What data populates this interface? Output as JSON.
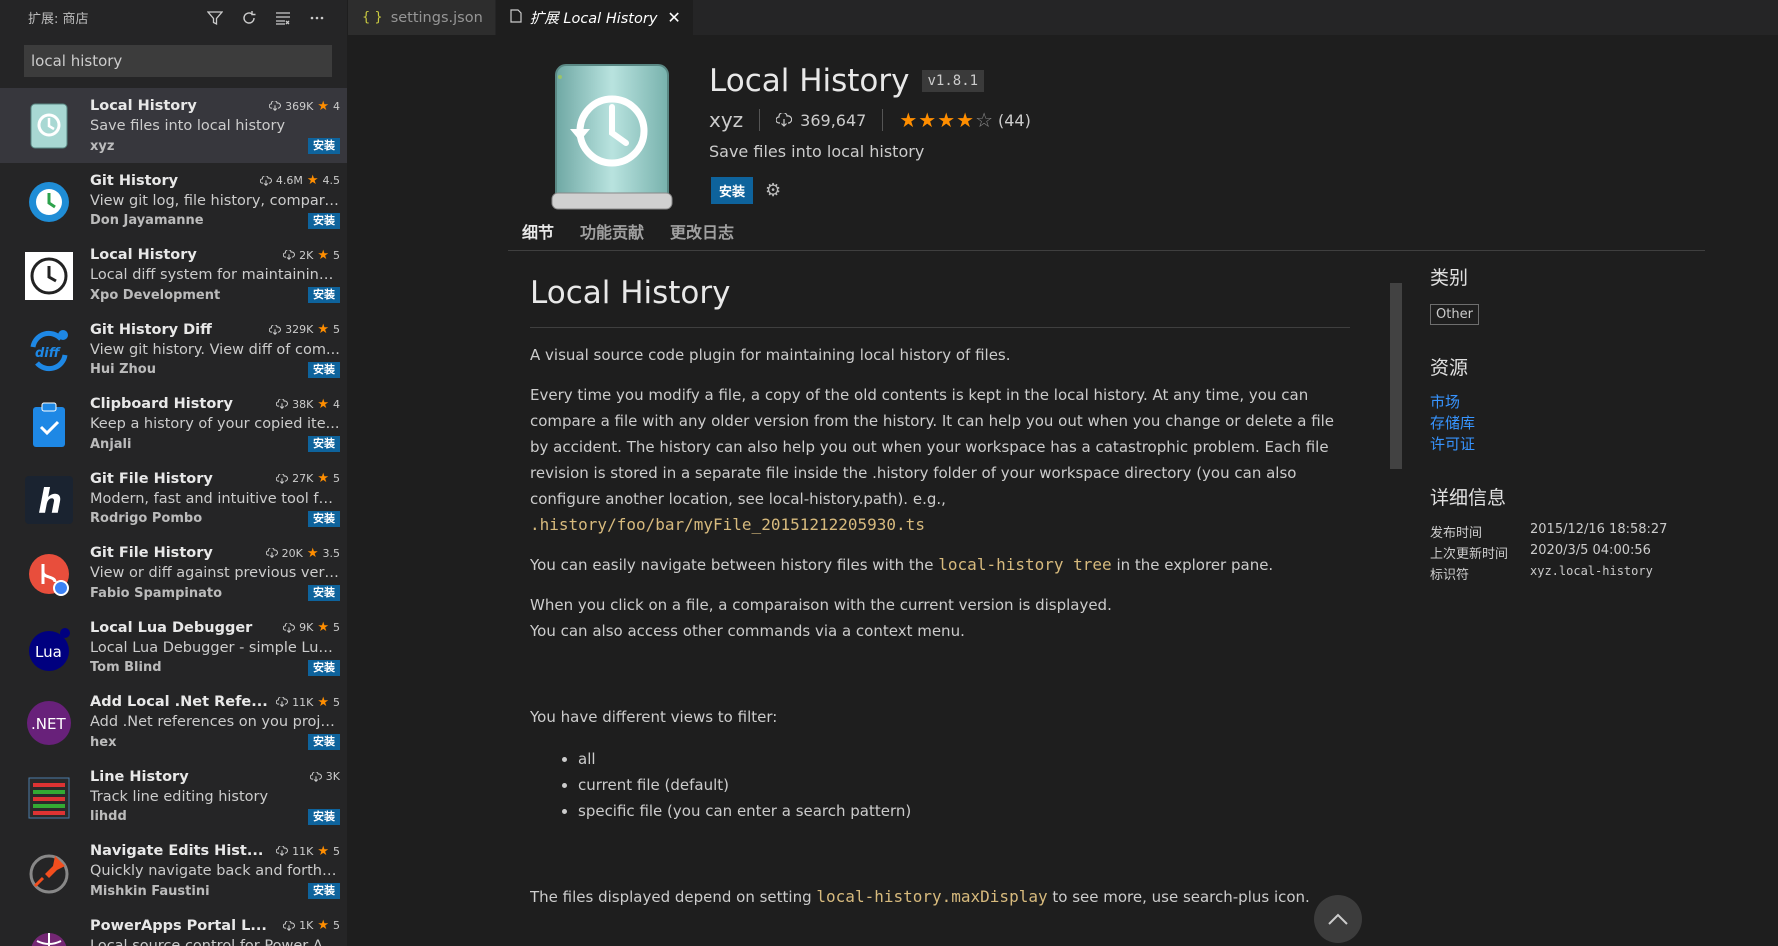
{
  "sidebar": {
    "title": "扩展: 商店",
    "search_value": "local history",
    "install_label": "安装",
    "extensions": [
      {
        "name": "Local History",
        "downloads": "369K",
        "rating": "4",
        "desc": "Save files into local history",
        "publisher": "xyz",
        "icon": "drive-history-icon"
      },
      {
        "name": "Git History",
        "downloads": "4.6M",
        "rating": "4.5",
        "desc": "View git log, file history, compare...",
        "publisher": "Don Jayamanne",
        "icon": "git-history-icon"
      },
      {
        "name": "Local History",
        "downloads": "2K",
        "rating": "5",
        "desc": "Local diff system for maintaining ...",
        "publisher": "Xpo Development",
        "icon": "clock-history-icon"
      },
      {
        "name": "Git History Diff",
        "downloads": "329K",
        "rating": "5",
        "desc": "View git history. View diff of com...",
        "publisher": "Hui Zhou",
        "icon": "diff-icon"
      },
      {
        "name": "Clipboard History",
        "downloads": "38K",
        "rating": "4",
        "desc": "Keep a history of your copied ite...",
        "publisher": "Anjali",
        "icon": "clipboard-icon"
      },
      {
        "name": "Git File History",
        "downloads": "27K",
        "rating": "5",
        "desc": "Modern, fast and intuitive tool for...",
        "publisher": "Rodrigo Pombo",
        "icon": "h-logo-icon"
      },
      {
        "name": "Git File History",
        "downloads": "20K",
        "rating": "3.5",
        "desc": "View or diff against previous versi...",
        "publisher": "Fabio Spampinato",
        "icon": "git-branch-icon"
      },
      {
        "name": "Local Lua Debugger",
        "downloads": "9K",
        "rating": "5",
        "desc": "Local Lua Debugger - simple Lua ...",
        "publisher": "Tom Blind",
        "icon": "lua-icon"
      },
      {
        "name": "Add Local .Net Refe...",
        "downloads": "11K",
        "rating": "5",
        "desc": "Add .Net references on you project",
        "publisher": "hex",
        "icon": "dotnet-icon"
      },
      {
        "name": "Line History",
        "downloads": "3K",
        "rating": "",
        "desc": "Track line editing history",
        "publisher": "lihdd",
        "icon": "lines-icon"
      },
      {
        "name": "Navigate Edits Hist...",
        "downloads": "11K",
        "rating": "5",
        "desc": "Quickly navigate back and forth b...",
        "publisher": "Mishkin Faustini",
        "icon": "pin-icon"
      },
      {
        "name": "PowerApps Portal L...",
        "downloads": "1K",
        "rating": "5",
        "desc": "Local source control for Power Ap...",
        "publisher": "",
        "icon": "globe-icon"
      }
    ]
  },
  "tabs": [
    {
      "label": "settings.json",
      "icon": "{ }"
    },
    {
      "label": "扩展 Local History",
      "icon": "file-icon"
    }
  ],
  "header": {
    "title": "Local History",
    "version": "v1.8.1",
    "publisher": "xyz",
    "downloads": "369,647",
    "rating_count": "(44)",
    "rating": 4,
    "description": "Save files into local history",
    "install_label": "安装"
  },
  "nav": [
    "细节",
    "功能贡献",
    "更改日志"
  ],
  "readme": {
    "h1": "Local History",
    "p1": "A visual source code plugin for maintaining local history of files.",
    "p2": "Every time you modify a file, a copy of the old contents is kept in the local history. At any time, you can compare a file with any older version from the history. It can help you out when you change or delete a file by accident. The history can also help you out when your workspace has a catastrophic problem. Each file revision is stored in a separate file inside the .history folder of your workspace directory (you can also configure another location, see local-history.path). e.g.,",
    "p2_code": ".history/foo/bar/myFile_20151212205930.ts",
    "p3_a": "You can easily navigate between history files with the ",
    "p3_code": "local-history tree",
    "p3_b": " in the explorer pane.",
    "p4_a": "When you click on a file, a comparaison with the current version is displayed.",
    "p4_b": "You can also access other commands via a context menu.",
    "p5": "You have different views to filter:",
    "list": [
      "all",
      "current file (default)",
      "specific file (you can enter a search pattern)"
    ],
    "p6_a": "The files displayed depend on setting ",
    "p6_code": "local-history.maxDisplay",
    "p6_b": " to see more, use search-plus icon."
  },
  "side": {
    "categories_title": "类别",
    "category": "Other",
    "resources_title": "资源",
    "links": [
      "市场",
      "存储库",
      "许可证"
    ],
    "details_title": "详细信息",
    "details": [
      {
        "k": "发布时间",
        "v": "2015/12/16 18:58:27"
      },
      {
        "k": "上次更新时间",
        "v": "2020/3/5 04:00:56"
      },
      {
        "k": "标识符",
        "v": "xyz.local-history"
      }
    ]
  },
  "colors": {
    "accent": "#0e639c",
    "star": "#ff8e00",
    "link": "#3794ff"
  }
}
